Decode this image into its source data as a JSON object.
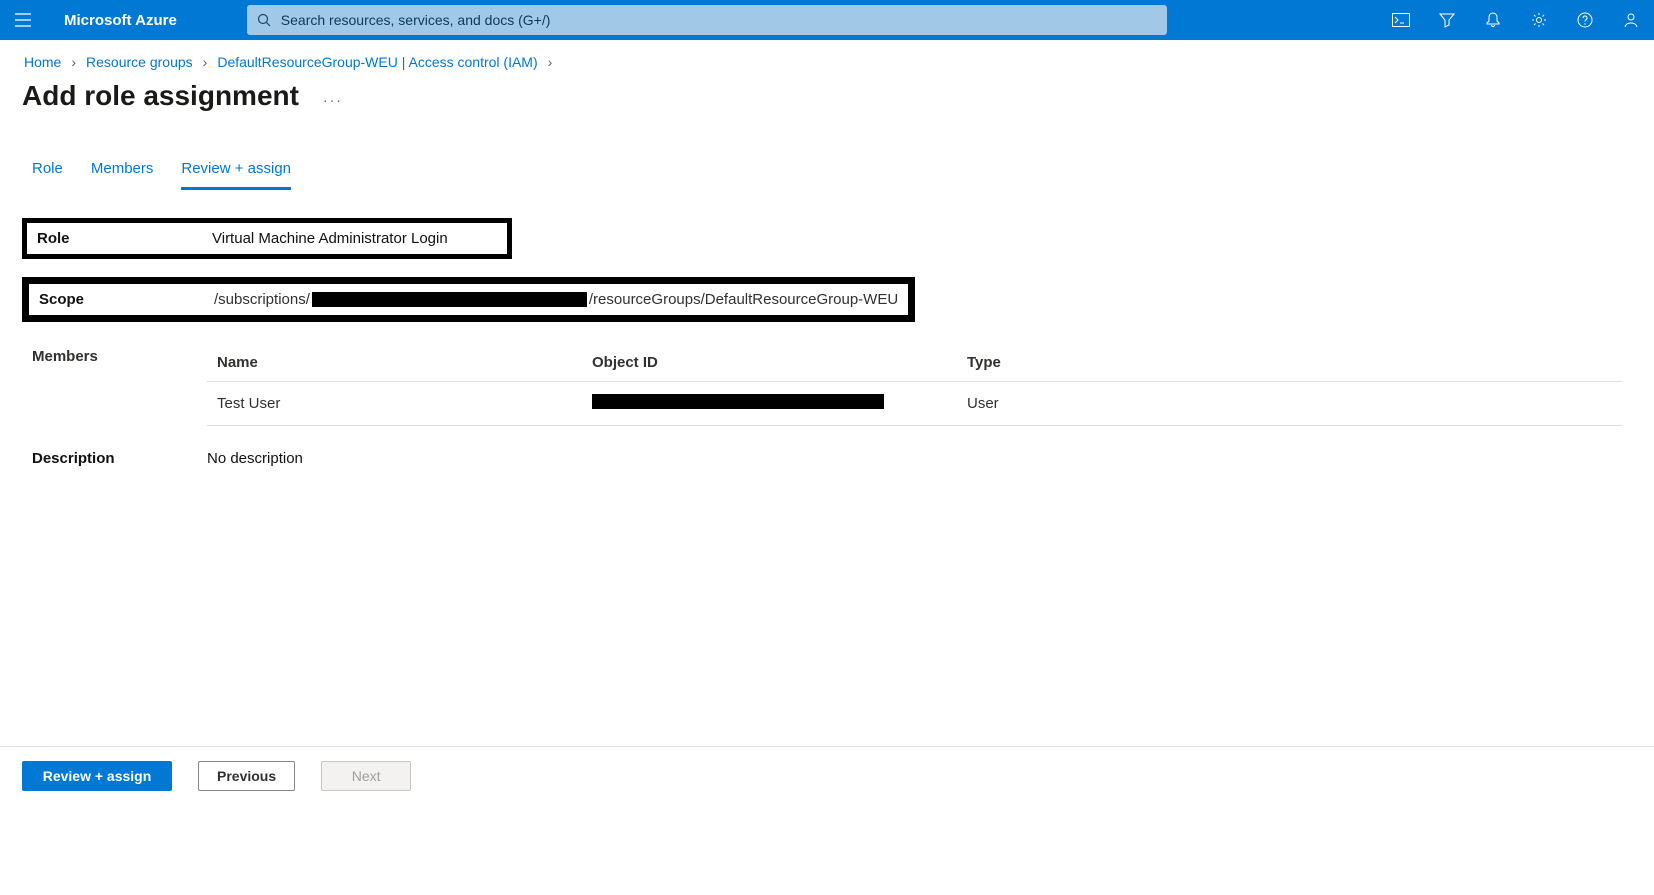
{
  "brand": "Microsoft Azure",
  "search": {
    "placeholder": "Search resources, services, and docs (G+/)"
  },
  "breadcrumb": {
    "items": [
      "Home",
      "Resource groups",
      "DefaultResourceGroup-WEU | Access control (IAM)"
    ]
  },
  "page": {
    "title": "Add role assignment"
  },
  "tabs": {
    "items": [
      "Role",
      "Members",
      "Review + assign"
    ],
    "active_index": 2
  },
  "review": {
    "role_label": "Role",
    "role_value": "Virtual Machine Administrator Login",
    "scope_label": "Scope",
    "scope_prefix": "/subscriptions/",
    "scope_suffix": "/resourceGroups/DefaultResourceGroup-WEU",
    "members_label": "Members",
    "members": {
      "headers": {
        "name": "Name",
        "object_id": "Object ID",
        "type": "Type"
      },
      "rows": [
        {
          "name": "Test User",
          "object_id": "",
          "type": "User"
        }
      ]
    },
    "description_label": "Description",
    "description_value": "No description"
  },
  "footer": {
    "primary": "Review + assign",
    "previous": "Previous",
    "next": "Next"
  }
}
